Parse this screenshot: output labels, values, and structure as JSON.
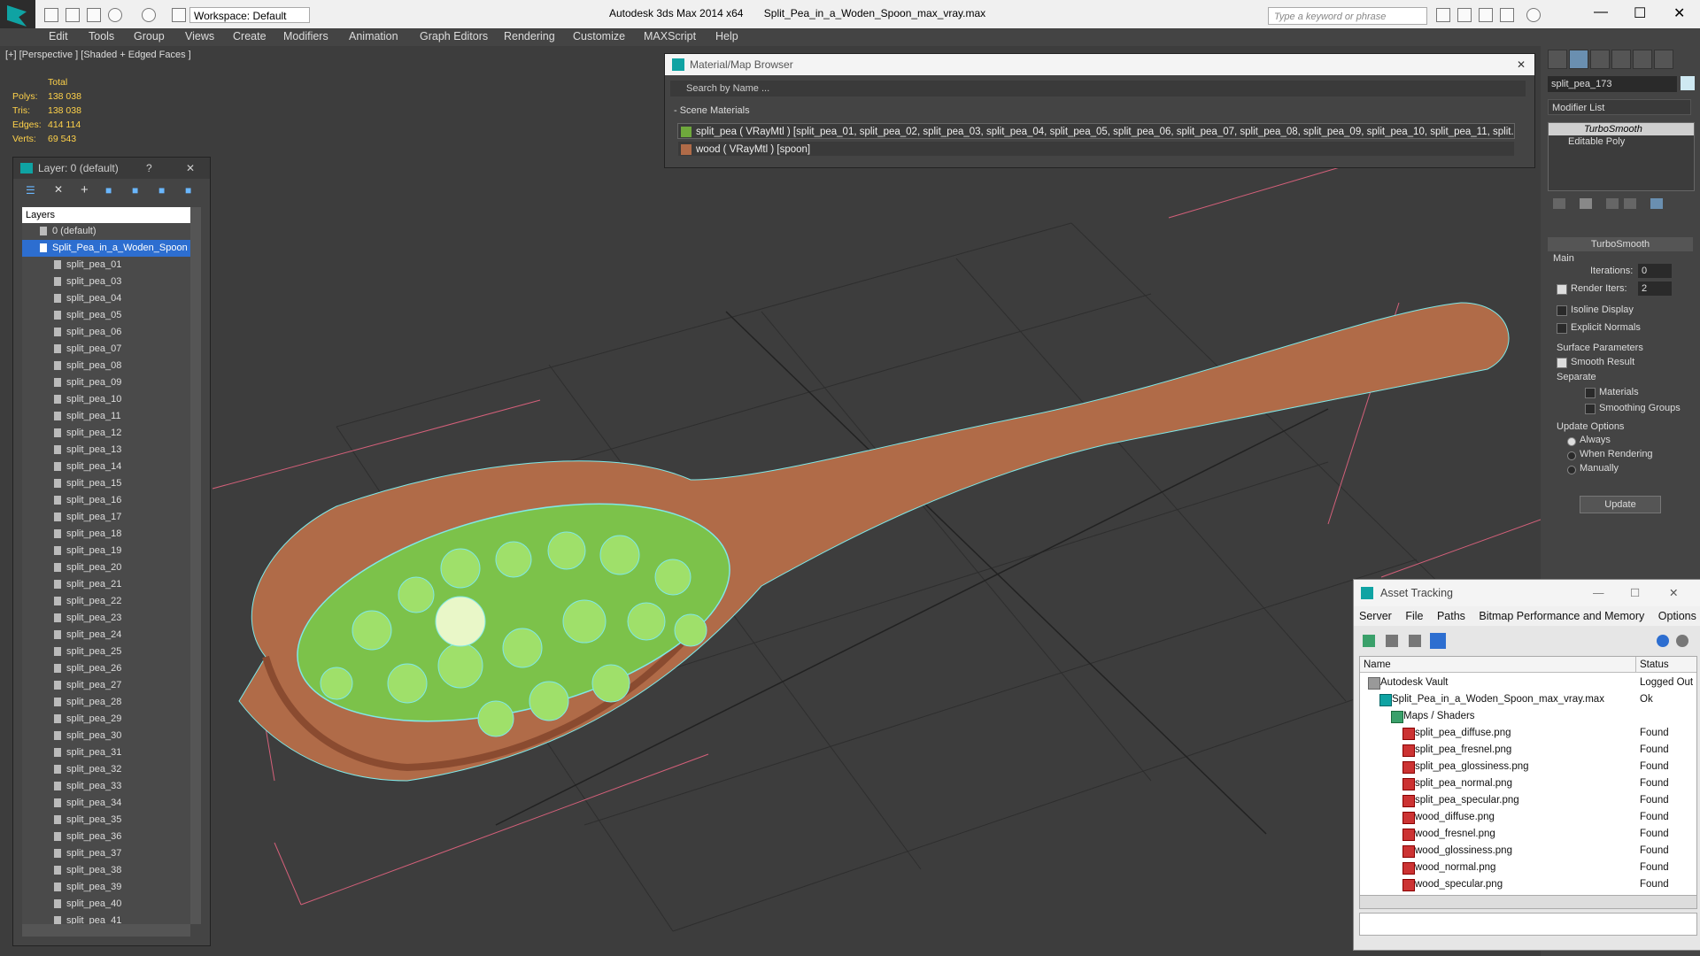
{
  "titlebar": {
    "workspace": "Workspace: Default",
    "app": "Autodesk 3ds Max  2014 x64",
    "file": "Split_Pea_in_a_Woden_Spoon_max_vray.max",
    "search_placeholder": "Type a keyword or phrase"
  },
  "menu": [
    "Edit",
    "Tools",
    "Group",
    "Views",
    "Create",
    "Modifiers",
    "Animation",
    "Graph Editors",
    "Rendering",
    "Customize",
    "MAXScript",
    "Help"
  ],
  "viewport": {
    "label": "[+] [Perspective ] [Shaded + Edged Faces ]",
    "stats": {
      "header": "Total",
      "polys_label": "Polys:",
      "polys": "138 038",
      "tris_label": "Tris:",
      "tris": "138 038",
      "edges_label": "Edges:",
      "edges": "414 114",
      "verts_label": "Verts:",
      "verts": "69 543"
    }
  },
  "layer_panel": {
    "title": "Layer: 0 (default)",
    "help": "?",
    "header": "Layers",
    "default_layer": "0 (default)",
    "selected_layer": "Split_Pea_in_a_Woden_Spoon",
    "items": [
      "split_pea_01",
      "split_pea_03",
      "split_pea_04",
      "split_pea_05",
      "split_pea_06",
      "split_pea_07",
      "split_pea_08",
      "split_pea_09",
      "split_pea_10",
      "split_pea_11",
      "split_pea_12",
      "split_pea_13",
      "split_pea_14",
      "split_pea_15",
      "split_pea_16",
      "split_pea_17",
      "split_pea_18",
      "split_pea_19",
      "split_pea_20",
      "split_pea_21",
      "split_pea_22",
      "split_pea_23",
      "split_pea_24",
      "split_pea_25",
      "split_pea_26",
      "split_pea_27",
      "split_pea_28",
      "split_pea_29",
      "split_pea_30",
      "split_pea_31",
      "split_pea_32",
      "split_pea_33",
      "split_pea_34",
      "split_pea_35",
      "split_pea_36",
      "split_pea_37",
      "split_pea_38",
      "split_pea_39",
      "split_pea_40",
      "split_pea_41"
    ]
  },
  "material_browser": {
    "title": "Material/Map Browser",
    "search_placeholder": "Search by Name ...",
    "section": "- Scene Materials",
    "materials": [
      "split_pea ( VRayMtl ) [split_pea_01, split_pea_02, split_pea_03, split_pea_04, split_pea_05, split_pea_06, split_pea_07, split_pea_08, split_pea_09, split_pea_10, split_pea_11, split...",
      "wood  ( VRayMtl ) [spoon]"
    ]
  },
  "command_panel": {
    "object_name": "split_pea_173",
    "modifier_list": "Modifier List",
    "stack": [
      "TurboSmooth",
      "Editable Poly"
    ],
    "rollout_title": "TurboSmooth",
    "main_label": "Main",
    "iterations_label": "Iterations:",
    "iterations": "0",
    "render_iters_label": "Render Iters:",
    "render_iters": "2",
    "isoline": "Isoline Display",
    "explicit": "Explicit Normals",
    "surface_params": "Surface Parameters",
    "smooth_result": "Smooth Result",
    "separate": "Separate",
    "materials": "Materials",
    "smoothing_groups": "Smoothing Groups",
    "update_options": "Update Options",
    "always": "Always",
    "when_rendering": "When Rendering",
    "manually": "Manually",
    "update_button": "Update"
  },
  "asset_tracking": {
    "title": "Asset Tracking",
    "menu": [
      "Server",
      "File",
      "Paths",
      "Bitmap Performance and Memory",
      "Options"
    ],
    "col_name": "Name",
    "col_status": "Status",
    "rows": [
      {
        "name": "Autodesk Vault",
        "status": "Logged Out",
        "indent": 1
      },
      {
        "name": "Split_Pea_in_a_Woden_Spoon_max_vray.max",
        "status": "Ok",
        "indent": 2
      },
      {
        "name": "Maps / Shaders",
        "status": "",
        "indent": 3
      },
      {
        "name": "split_pea_diffuse.png",
        "status": "Found",
        "indent": 4
      },
      {
        "name": "split_pea_fresnel.png",
        "status": "Found",
        "indent": 4
      },
      {
        "name": "split_pea_glossiness.png",
        "status": "Found",
        "indent": 4
      },
      {
        "name": "split_pea_normal.png",
        "status": "Found",
        "indent": 4
      },
      {
        "name": "split_pea_specular.png",
        "status": "Found",
        "indent": 4
      },
      {
        "name": "wood_diffuse.png",
        "status": "Found",
        "indent": 4
      },
      {
        "name": "wood_fresnel.png",
        "status": "Found",
        "indent": 4
      },
      {
        "name": "wood_glossiness.png",
        "status": "Found",
        "indent": 4
      },
      {
        "name": "wood_normal.png",
        "status": "Found",
        "indent": 4
      },
      {
        "name": "wood_specular.png",
        "status": "Found",
        "indent": 4
      }
    ]
  },
  "colors": {
    "accent": "#2d6ed0",
    "grid": "#5a5a5a",
    "wood": "#b06b48",
    "pea": "#7cc24a",
    "wire": "#7fe8e8"
  }
}
